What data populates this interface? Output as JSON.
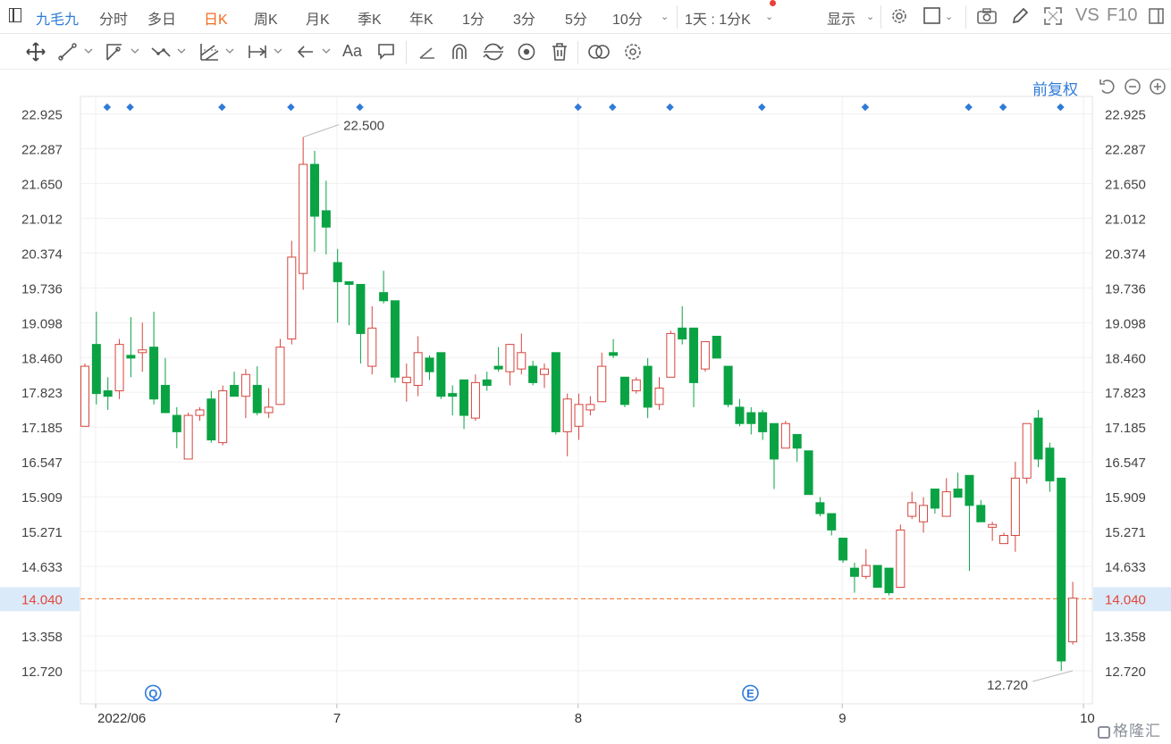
{
  "header": {
    "symbol": "九毛九",
    "periods": [
      "分时",
      "多日",
      "日K",
      "周K",
      "月K",
      "季K",
      "年K",
      "1分",
      "3分",
      "5分",
      "10分"
    ],
    "active_period": "日K",
    "multi_period": "1天 : 1分K",
    "display_label": "显示",
    "vs_label": "VS",
    "f10_label": "F10"
  },
  "toolbar_icons": [
    "move-icon",
    "line-icon",
    "ray-icon",
    "polyline-icon",
    "channel-icon",
    "measure-icon",
    "arrow-back-icon",
    "text-icon",
    "comment-icon",
    "angle-icon",
    "magnet-icon",
    "sync-icon",
    "eye-icon",
    "trash-icon",
    "compare-icon",
    "settings-icon"
  ],
  "adjust_label": "前复权",
  "colors": {
    "up": "#d6453e",
    "down": "#0aa344",
    "accent": "#2f7bd9",
    "current": "#f26b1d",
    "current_bg": "#dbeaf8"
  },
  "chart_data": {
    "type": "candlestick",
    "y_ticks": [
      "22.925",
      "22.287",
      "21.650",
      "21.012",
      "20.374",
      "19.736",
      "19.098",
      "18.460",
      "17.823",
      "17.185",
      "16.547",
      "15.909",
      "15.271",
      "14.633",
      "13.358",
      "12.720"
    ],
    "ylim": [
      12.72,
      22.925
    ],
    "x_labels": [
      {
        "label": "2022/06",
        "index": 0
      },
      {
        "label": "7",
        "index": 21
      },
      {
        "label": "8",
        "index": 42
      },
      {
        "label": "9",
        "index": 65
      },
      {
        "label": "10",
        "index": 86
      }
    ],
    "current_price": "14.040",
    "max_label": {
      "value": "22.500",
      "index": 19
    },
    "min_label": {
      "value": "12.720",
      "index": 86
    },
    "event_markers": [
      {
        "label": "Q",
        "index": 5
      },
      {
        "label": "E",
        "index": 57
      }
    ],
    "dividend_dots": [
      1,
      3,
      11,
      17,
      23,
      42,
      45,
      50,
      58,
      67,
      76,
      79,
      84
    ],
    "candles": [
      {
        "o": 17.2,
        "h": 18.35,
        "l": 17.2,
        "c": 18.3
      },
      {
        "o": 18.7,
        "h": 19.3,
        "l": 17.6,
        "c": 17.8
      },
      {
        "o": 17.85,
        "h": 18.1,
        "l": 17.5,
        "c": 17.75
      },
      {
        "o": 17.85,
        "h": 18.8,
        "l": 17.7,
        "c": 18.7
      },
      {
        "o": 18.5,
        "h": 19.2,
        "l": 18.1,
        "c": 18.45
      },
      {
        "o": 18.55,
        "h": 19.1,
        "l": 18.2,
        "c": 18.6
      },
      {
        "o": 18.65,
        "h": 19.3,
        "l": 17.6,
        "c": 17.7
      },
      {
        "o": 17.95,
        "h": 18.45,
        "l": 17.5,
        "c": 17.45
      },
      {
        "o": 17.4,
        "h": 17.55,
        "l": 16.8,
        "c": 17.1
      },
      {
        "o": 16.6,
        "h": 17.45,
        "l": 16.6,
        "c": 17.4
      },
      {
        "o": 17.4,
        "h": 17.55,
        "l": 17.3,
        "c": 17.5
      },
      {
        "o": 17.7,
        "h": 17.85,
        "l": 16.9,
        "c": 16.95
      },
      {
        "o": 16.9,
        "h": 17.95,
        "l": 16.85,
        "c": 17.85
      },
      {
        "o": 17.95,
        "h": 18.2,
        "l": 17.75,
        "c": 17.75
      },
      {
        "o": 17.75,
        "h": 18.25,
        "l": 17.35,
        "c": 18.15
      },
      {
        "o": 17.95,
        "h": 18.3,
        "l": 17.4,
        "c": 17.45
      },
      {
        "o": 17.45,
        "h": 17.9,
        "l": 17.35,
        "c": 17.55
      },
      {
        "o": 17.6,
        "h": 18.8,
        "l": 17.6,
        "c": 18.65
      },
      {
        "o": 18.8,
        "h": 20.6,
        "l": 18.7,
        "c": 20.3
      },
      {
        "o": 20.0,
        "h": 22.5,
        "l": 19.7,
        "c": 22.0
      },
      {
        "o": 22.0,
        "h": 22.25,
        "l": 20.4,
        "c": 21.05
      },
      {
        "o": 21.15,
        "h": 21.7,
        "l": 20.35,
        "c": 20.85
      },
      {
        "o": 20.2,
        "h": 20.45,
        "l": 19.1,
        "c": 19.85
      },
      {
        "o": 19.85,
        "h": 19.85,
        "l": 19.05,
        "c": 19.8
      },
      {
        "o": 19.8,
        "h": 19.8,
        "l": 18.35,
        "c": 18.9
      },
      {
        "o": 18.3,
        "h": 19.4,
        "l": 18.15,
        "c": 19.0
      },
      {
        "o": 19.65,
        "h": 20.05,
        "l": 19.45,
        "c": 19.5
      },
      {
        "o": 19.5,
        "h": 19.5,
        "l": 18.0,
        "c": 18.1
      },
      {
        "o": 18.0,
        "h": 18.35,
        "l": 17.65,
        "c": 18.1
      },
      {
        "o": 17.95,
        "h": 18.85,
        "l": 17.75,
        "c": 18.55
      },
      {
        "o": 18.45,
        "h": 18.5,
        "l": 18.05,
        "c": 18.2
      },
      {
        "o": 18.55,
        "h": 18.55,
        "l": 17.7,
        "c": 17.75
      },
      {
        "o": 17.8,
        "h": 17.95,
        "l": 17.4,
        "c": 17.75
      },
      {
        "o": 18.05,
        "h": 18.05,
        "l": 17.15,
        "c": 17.4
      },
      {
        "o": 17.35,
        "h": 18.15,
        "l": 17.3,
        "c": 18.0
      },
      {
        "o": 18.05,
        "h": 18.2,
        "l": 17.85,
        "c": 17.95
      },
      {
        "o": 18.3,
        "h": 18.65,
        "l": 18.2,
        "c": 18.25
      },
      {
        "o": 18.2,
        "h": 18.7,
        "l": 17.95,
        "c": 18.7
      },
      {
        "o": 18.25,
        "h": 18.9,
        "l": 18.15,
        "c": 18.55
      },
      {
        "o": 18.3,
        "h": 18.4,
        "l": 17.95,
        "c": 18.0
      },
      {
        "o": 18.15,
        "h": 18.35,
        "l": 17.9,
        "c": 18.25
      },
      {
        "o": 18.55,
        "h": 18.55,
        "l": 17.05,
        "c": 17.1
      },
      {
        "o": 17.1,
        "h": 17.8,
        "l": 16.65,
        "c": 17.7
      },
      {
        "o": 17.2,
        "h": 17.8,
        "l": 16.95,
        "c": 17.6
      },
      {
        "o": 17.5,
        "h": 17.75,
        "l": 17.4,
        "c": 17.6
      },
      {
        "o": 17.65,
        "h": 18.55,
        "l": 17.65,
        "c": 18.3
      },
      {
        "o": 18.55,
        "h": 18.8,
        "l": 18.45,
        "c": 18.5
      },
      {
        "o": 18.1,
        "h": 18.1,
        "l": 17.55,
        "c": 17.6
      },
      {
        "o": 17.85,
        "h": 18.1,
        "l": 17.8,
        "c": 18.05
      },
      {
        "o": 18.3,
        "h": 18.45,
        "l": 17.35,
        "c": 17.55
      },
      {
        "o": 17.6,
        "h": 18.1,
        "l": 17.5,
        "c": 17.9
      },
      {
        "o": 18.1,
        "h": 18.95,
        "l": 18.1,
        "c": 18.9
      },
      {
        "o": 19.0,
        "h": 19.4,
        "l": 18.7,
        "c": 18.8
      },
      {
        "o": 19.0,
        "h": 19.0,
        "l": 17.55,
        "c": 18.0
      },
      {
        "o": 18.25,
        "h": 18.75,
        "l": 18.2,
        "c": 18.75
      },
      {
        "o": 18.85,
        "h": 18.85,
        "l": 18.45,
        "c": 18.45
      },
      {
        "o": 18.3,
        "h": 18.3,
        "l": 17.55,
        "c": 17.6
      },
      {
        "o": 17.55,
        "h": 17.7,
        "l": 17.2,
        "c": 17.25
      },
      {
        "o": 17.45,
        "h": 17.55,
        "l": 17.05,
        "c": 17.25
      },
      {
        "o": 17.45,
        "h": 17.5,
        "l": 16.95,
        "c": 17.1
      },
      {
        "o": 17.25,
        "h": 17.25,
        "l": 16.05,
        "c": 16.6
      },
      {
        "o": 16.8,
        "h": 17.3,
        "l": 16.8,
        "c": 17.25
      },
      {
        "o": 17.05,
        "h": 17.05,
        "l": 16.55,
        "c": 16.8
      },
      {
        "o": 16.75,
        "h": 16.75,
        "l": 15.95,
        "c": 15.95
      },
      {
        "o": 15.8,
        "h": 15.9,
        "l": 15.55,
        "c": 15.6
      },
      {
        "o": 15.6,
        "h": 15.6,
        "l": 15.2,
        "c": 15.3
      },
      {
        "o": 15.15,
        "h": 15.15,
        "l": 14.7,
        "c": 14.75
      },
      {
        "o": 14.6,
        "h": 14.7,
        "l": 14.15,
        "c": 14.45
      },
      {
        "o": 14.45,
        "h": 14.95,
        "l": 14.4,
        "c": 14.65
      },
      {
        "o": 14.65,
        "h": 14.65,
        "l": 14.25,
        "c": 14.25
      },
      {
        "o": 14.6,
        "h": 14.6,
        "l": 14.1,
        "c": 14.15
      },
      {
        "o": 14.25,
        "h": 15.4,
        "l": 14.25,
        "c": 15.3
      },
      {
        "o": 15.55,
        "h": 16.0,
        "l": 15.5,
        "c": 15.8
      },
      {
        "o": 15.45,
        "h": 15.9,
        "l": 15.25,
        "c": 15.75
      },
      {
        "o": 16.05,
        "h": 16.05,
        "l": 15.6,
        "c": 15.7
      },
      {
        "o": 15.55,
        "h": 16.25,
        "l": 15.55,
        "c": 16.0
      },
      {
        "o": 16.05,
        "h": 16.35,
        "l": 15.95,
        "c": 15.9
      },
      {
        "o": 16.3,
        "h": 16.3,
        "l": 14.55,
        "c": 15.75
      },
      {
        "o": 15.75,
        "h": 15.85,
        "l": 15.45,
        "c": 15.45
      },
      {
        "o": 15.35,
        "h": 15.45,
        "l": 15.1,
        "c": 15.4
      },
      {
        "o": 15.05,
        "h": 15.25,
        "l": 15.05,
        "c": 15.2
      },
      {
        "o": 15.2,
        "h": 16.55,
        "l": 14.9,
        "c": 16.25
      },
      {
        "o": 16.25,
        "h": 17.25,
        "l": 16.15,
        "c": 17.25
      },
      {
        "o": 17.35,
        "h": 17.5,
        "l": 16.45,
        "c": 16.6
      },
      {
        "o": 16.8,
        "h": 16.9,
        "l": 16.0,
        "c": 16.2
      },
      {
        "o": 16.25,
        "h": 16.25,
        "l": 12.72,
        "c": 12.9
      },
      {
        "o": 13.25,
        "h": 14.35,
        "l": 13.2,
        "c": 14.05
      }
    ]
  }
}
